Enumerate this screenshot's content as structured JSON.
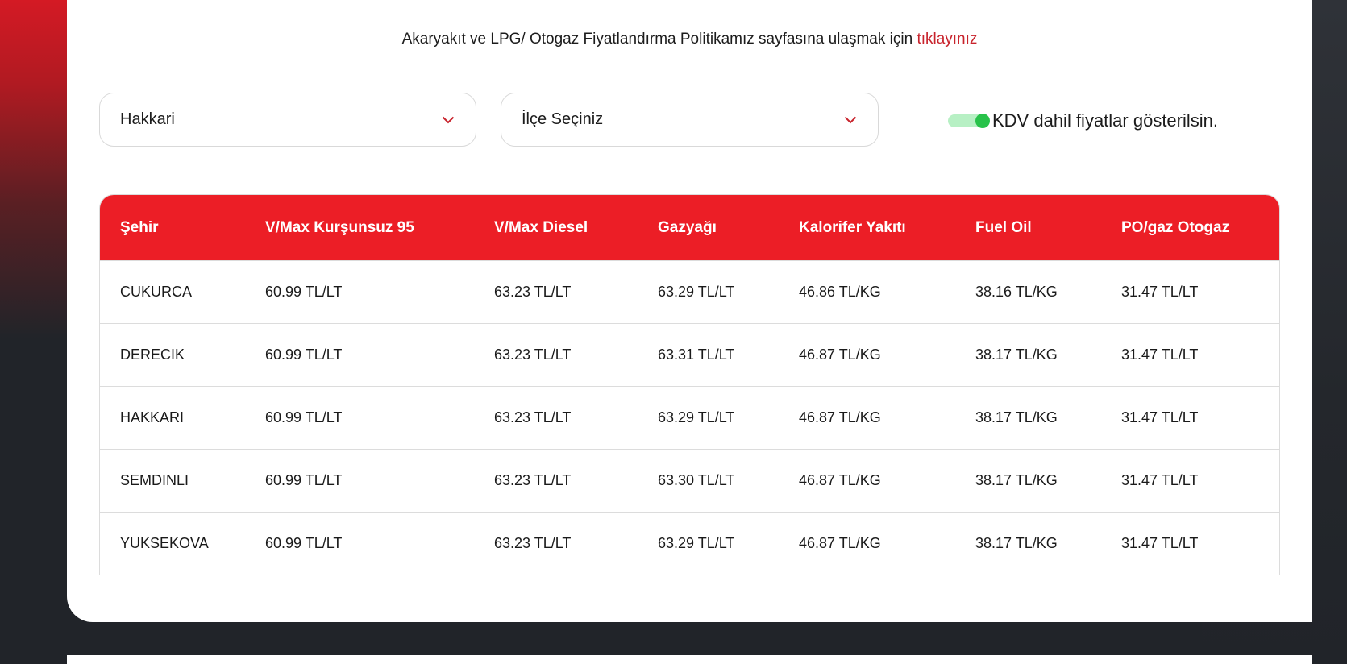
{
  "policy": {
    "text": "Akaryakıt ve LPG/ Otogaz Fiyatlandırma Politikamız sayfasına ulaşmak için ",
    "link": "tıklayınız"
  },
  "filters": {
    "city": "Hakkari",
    "district": "İlçe Seçiniz"
  },
  "vat_toggle": {
    "label": "KDV dahil fiyatlar gösterilsin.",
    "on": true
  },
  "table": {
    "headers": [
      "Şehir",
      "V/Max Kurşunsuz 95",
      "V/Max Diesel",
      "Gazyağı",
      "Kalorifer Yakıtı",
      "Fuel Oil",
      "PO/gaz Otogaz"
    ],
    "rows": [
      [
        "CUKURCA",
        "60.99 TL/LT",
        "63.23 TL/LT",
        "63.29 TL/LT",
        "46.86 TL/KG",
        "38.16 TL/KG",
        "31.47 TL/LT"
      ],
      [
        "DERECIK",
        "60.99 TL/LT",
        "63.23 TL/LT",
        "63.31 TL/LT",
        "46.87 TL/KG",
        "38.17 TL/KG",
        "31.47 TL/LT"
      ],
      [
        "HAKKARI",
        "60.99 TL/LT",
        "63.23 TL/LT",
        "63.29 TL/LT",
        "46.87 TL/KG",
        "38.17 TL/KG",
        "31.47 TL/LT"
      ],
      [
        "SEMDINLI",
        "60.99 TL/LT",
        "63.23 TL/LT",
        "63.30 TL/LT",
        "46.87 TL/KG",
        "38.17 TL/KG",
        "31.47 TL/LT"
      ],
      [
        "YUKSEKOVA",
        "60.99 TL/LT",
        "63.23 TL/LT",
        "63.29 TL/LT",
        "46.87 TL/KG",
        "38.17 TL/KG",
        "31.47 TL/LT"
      ]
    ]
  },
  "colors": {
    "brand_red": "#ec1e26",
    "link_red": "#c8232c",
    "toggle_green": "#28c24a"
  },
  "icons": {
    "dropdown": "chevron-down-icon"
  }
}
